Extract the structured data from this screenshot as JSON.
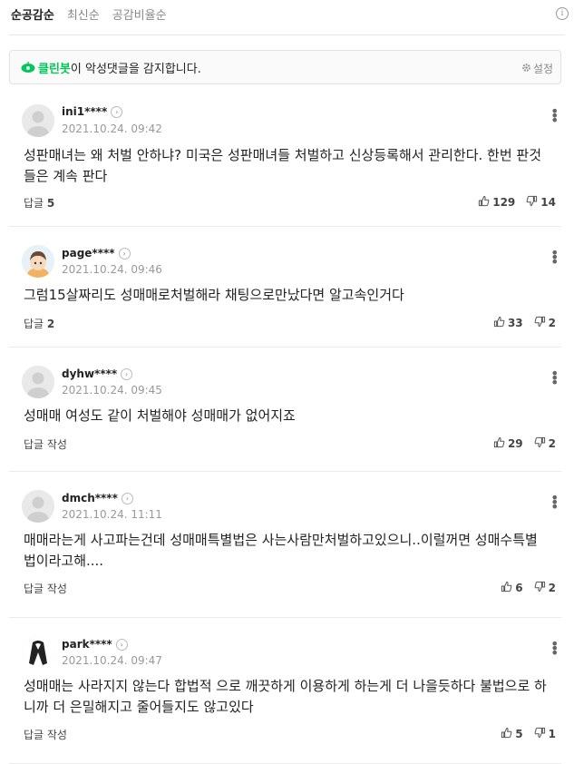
{
  "sort": {
    "tabs": [
      "순공감순",
      "최신순",
      "공감비율순"
    ]
  },
  "info_glyph": "i",
  "cleanbot": {
    "name": "클린봇",
    "message": "이 악성댓글을 감지합니다.",
    "settings_label": "설정"
  },
  "comments": [
    {
      "user": "ini1****",
      "date": "2021.10.24. 09:42",
      "text": "성판매녀는 왜 처벌 안하냐? 미국은 성판매녀들 처벌하고 신상등록해서 관리한다. 한번 판것들은 계속 판다",
      "reply_label": "답글",
      "reply_count": "5",
      "likes": "129",
      "dislikes": "14",
      "avatar": "default"
    },
    {
      "user": "page****",
      "date": "2021.10.24. 09:46",
      "text": "그럼15살짜리도 성매매로처벌해라 채팅으로만났다면 알고속인거다",
      "reply_label": "답글",
      "reply_count": "2",
      "likes": "33",
      "dislikes": "2",
      "avatar": "character"
    },
    {
      "user": "dyhw****",
      "date": "2021.10.24. 09:45",
      "text": "성매매 여성도 같이 처벌해야 성매매가 없어지죠",
      "reply_label": "답글 작성",
      "reply_count": "",
      "likes": "29",
      "dislikes": "2",
      "avatar": "default"
    },
    {
      "user": "dmch****",
      "date": "2021.10.24. 11:11",
      "text": "매매라는게 사고파는건데 성매매특별법은 사는사람만처벌하고있으니..이럴꺼면 성매수특별법이라고해....",
      "reply_label": "답글 작성",
      "reply_count": "",
      "likes": "6",
      "dislikes": "2",
      "avatar": "default"
    },
    {
      "user": "park****",
      "date": "2021.10.24. 09:47",
      "text": "성매매는 사라지지 않는다 합법적 으로 깨끗하게 이용하게 하는게 더 나을듯하다 불법으로 하니까 더 은밀해지고 줄어들지도 않고있다",
      "reply_label": "답글 작성",
      "reply_count": "",
      "likes": "5",
      "dislikes": "1",
      "avatar": "ribbon"
    }
  ]
}
